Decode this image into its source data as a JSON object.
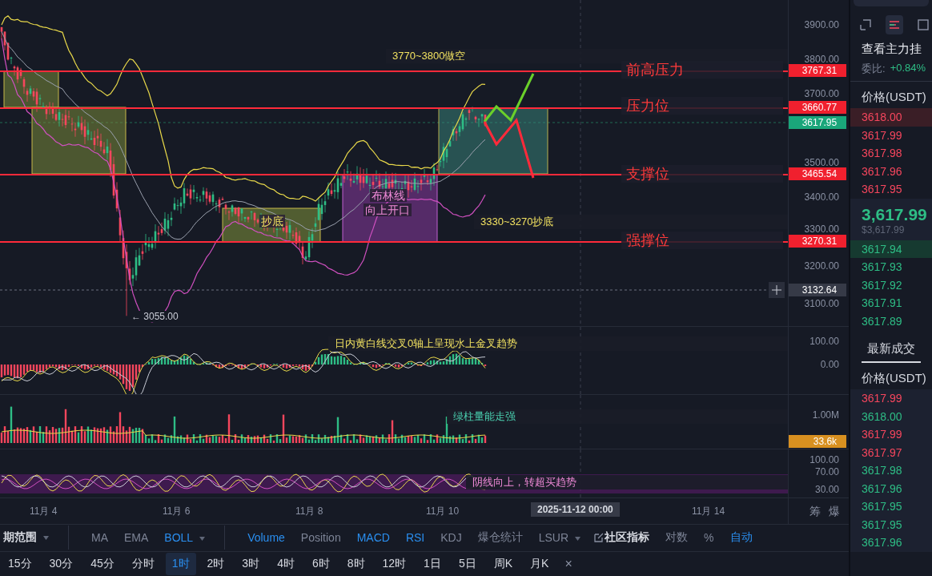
{
  "main_chart": {
    "levels": [
      {
        "label": "前高压力"
      },
      {
        "label": "压力位"
      },
      {
        "label": "支撑位"
      },
      {
        "label": "强撑位"
      }
    ],
    "notes": [
      {
        "text": "3770~3800做空"
      },
      {
        "text": "3330~3270抄底"
      }
    ],
    "zone_labels": [
      {
        "text": "抄底",
        "kind": "green"
      },
      {
        "text": "布林线",
        "kind": "purple"
      },
      {
        "text": "向上开口",
        "kind": "purple"
      }
    ],
    "low_marker": "← 3055.00",
    "axis_ticks": [
      "3900.00",
      "3800.00",
      "3700.00",
      "3500.00",
      "3400.00",
      "3300.00",
      "3200.00",
      "3100.00"
    ],
    "price_tags": [
      {
        "text": "3767.31",
        "kind": "level"
      },
      {
        "text": "3660.77",
        "kind": "level"
      },
      {
        "text": "3617.95",
        "kind": "last"
      },
      {
        "text": "3465.54",
        "kind": "level"
      },
      {
        "text": "3270.31",
        "kind": "level"
      },
      {
        "text": "3132.64",
        "kind": "cursor"
      }
    ]
  },
  "macd": {
    "note": "日内黄白线交叉0轴上呈现水上金叉趋势",
    "axis_ticks": [
      "100.00",
      "0.00"
    ]
  },
  "volume": {
    "note": "绿柱量能走强",
    "axis_ticks": [
      "1.00M"
    ],
    "tag": "33.6k"
  },
  "rsi": {
    "note": "阴线向上，转超买趋势",
    "axis_ticks": [
      "100.00",
      "70.00",
      "30.00"
    ]
  },
  "time_axis": {
    "labels": [
      "11月 4",
      "11月 6",
      "11月 8",
      "11月 10",
      "11月 14"
    ],
    "cursor_time": "2025-11-12 00:00",
    "side_buttons": [
      "筹",
      "爆"
    ]
  },
  "indicator_bar": {
    "groups": [
      [
        {
          "label": "期范围",
          "kind": "bold",
          "active": false,
          "dropdown": true
        }
      ],
      [
        {
          "label": "MA",
          "kind": "plain",
          "active": false,
          "dropdown": false
        },
        {
          "label": "EMA",
          "kind": "plain",
          "active": false,
          "dropdown": false
        },
        {
          "label": "BOLL",
          "kind": "plain",
          "active": true,
          "dropdown": true
        }
      ],
      [
        {
          "label": "Volume",
          "kind": "plain",
          "active": true,
          "dropdown": false
        },
        {
          "label": "Position",
          "kind": "plain",
          "active": false,
          "dropdown": false
        },
        {
          "label": "MACD",
          "kind": "plain",
          "active": true,
          "dropdown": false
        },
        {
          "label": "RSI",
          "kind": "plain",
          "active": true,
          "dropdown": false
        },
        {
          "label": "KDJ",
          "kind": "plain",
          "active": false,
          "dropdown": false
        },
        {
          "label": "爆仓统计",
          "kind": "plain",
          "active": false,
          "dropdown": false
        },
        {
          "label": "LSUR",
          "kind": "plain",
          "active": false,
          "dropdown": true
        },
        {
          "label": "社区指标",
          "kind": "community",
          "active": false,
          "dropdown": false
        },
        {
          "label": "对数",
          "kind": "plain",
          "active": false,
          "dropdown": false
        },
        {
          "label": "%",
          "kind": "plain",
          "active": false,
          "dropdown": false
        },
        {
          "label": "自动",
          "kind": "plain",
          "active": true,
          "dropdown": false
        }
      ]
    ]
  },
  "period_bar": {
    "items": [
      {
        "label": "15分",
        "selected": false
      },
      {
        "label": "30分",
        "selected": false
      },
      {
        "label": "45分",
        "selected": false
      },
      {
        "label": "分时",
        "selected": false
      },
      {
        "label": "1时",
        "selected": true
      },
      {
        "label": "2时",
        "selected": false
      },
      {
        "label": "3时",
        "selected": false
      },
      {
        "label": "4时",
        "selected": false
      },
      {
        "label": "6时",
        "selected": false
      },
      {
        "label": "8时",
        "selected": false
      },
      {
        "label": "12时",
        "selected": false
      },
      {
        "label": "1日",
        "selected": false
      },
      {
        "label": "5日",
        "selected": false
      },
      {
        "label": "周K",
        "selected": false
      },
      {
        "label": "月K",
        "selected": false
      }
    ],
    "close": "×"
  },
  "order_book": {
    "title": "查看主力挂",
    "ratio_label": "委比:",
    "ratio_value": "+0.84%",
    "price_header": "价格(USDT)",
    "asks": [
      {
        "price": "3618.00",
        "highlight": true
      },
      {
        "price": "3617.99",
        "highlight": false
      },
      {
        "price": "3617.98",
        "highlight": false
      },
      {
        "price": "3617.96",
        "highlight": false
      },
      {
        "price": "3617.95",
        "highlight": false
      }
    ],
    "last_price": "3,617.99",
    "last_price_usd": "$3,617.99",
    "bids": [
      {
        "price": "3617.94",
        "highlight": true
      },
      {
        "price": "3617.93",
        "highlight": false
      },
      {
        "price": "3617.92",
        "highlight": false
      },
      {
        "price": "3617.91",
        "highlight": false
      },
      {
        "price": "3617.89",
        "highlight": false
      }
    ]
  },
  "trades": {
    "title": "最新成交",
    "price_header": "价格(USDT)",
    "rows": [
      {
        "price": "3617.99",
        "color": "#f6465d"
      },
      {
        "price": "3618.00",
        "color": "#2ebd85"
      },
      {
        "price": "3617.99",
        "color": "#f6465d"
      },
      {
        "price": "3617.97",
        "color": "#f6465d"
      },
      {
        "price": "3617.98",
        "color": "#2ebd85"
      },
      {
        "price": "3617.96",
        "color": "#2ebd85"
      },
      {
        "price": "3617.95",
        "color": "#2ebd85"
      },
      {
        "price": "3617.95",
        "color": "#2ebd85"
      },
      {
        "price": "3617.96",
        "color": "#2ebd85"
      }
    ]
  }
}
